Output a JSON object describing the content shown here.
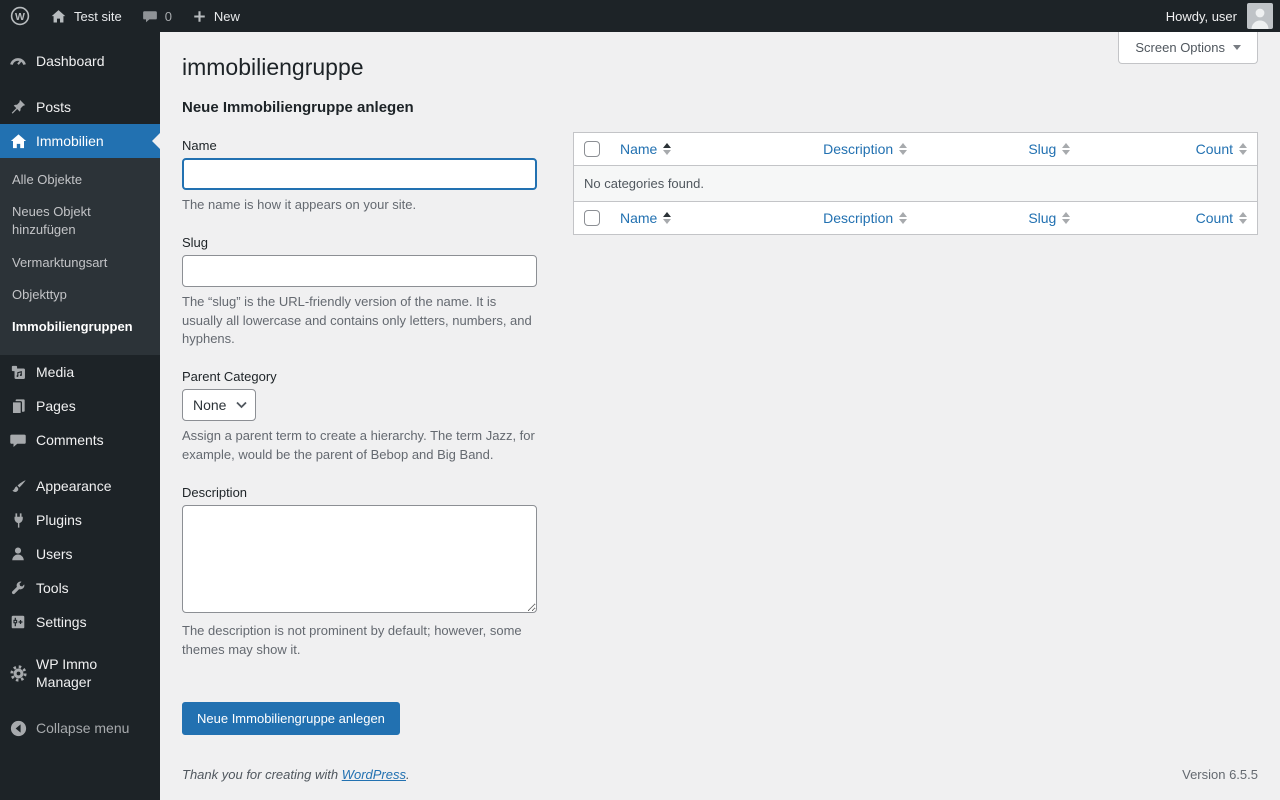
{
  "admin_bar": {
    "site_name": "Test site",
    "comments_count": "0",
    "new_label": "New",
    "howdy": "Howdy, user"
  },
  "sidebar": {
    "items": [
      {
        "label": "Dashboard",
        "icon": "dashboard-icon"
      },
      {
        "label": "Posts",
        "icon": "pin-icon"
      },
      {
        "label": "Immobilien",
        "icon": "house-icon",
        "active": true
      },
      {
        "label": "Media",
        "icon": "media-icon"
      },
      {
        "label": "Pages",
        "icon": "pages-icon"
      },
      {
        "label": "Comments",
        "icon": "comment-icon"
      },
      {
        "label": "Appearance",
        "icon": "brush-icon"
      },
      {
        "label": "Plugins",
        "icon": "plug-icon"
      },
      {
        "label": "Users",
        "icon": "user-icon"
      },
      {
        "label": "Tools",
        "icon": "wrench-icon"
      },
      {
        "label": "Settings",
        "icon": "settings-icon"
      },
      {
        "label": "WP Immo Manager",
        "icon": "gear-icon"
      }
    ],
    "submenu": [
      {
        "label": "Alle Objekte"
      },
      {
        "label": "Neues Objekt hinzufügen"
      },
      {
        "label": "Vermarktungsart"
      },
      {
        "label": "Objekttyp"
      },
      {
        "label": "Immobiliengruppen",
        "current": true
      }
    ],
    "collapse_label": "Collapse menu"
  },
  "page": {
    "title": "immobiliengruppe",
    "screen_options_label": "Screen Options"
  },
  "form": {
    "heading": "Neue Immobiliengruppe anlegen",
    "name_label": "Name",
    "name_value": "",
    "name_help": "The name is how it appears on your site.",
    "slug_label": "Slug",
    "slug_value": "",
    "slug_help": "The “slug” is the URL-friendly version of the name. It is usually all lowercase and contains only letters, numbers, and hyphens.",
    "parent_label": "Parent Category",
    "parent_value": "None",
    "parent_help": "Assign a parent term to create a hierarchy. The term Jazz, for example, would be the parent of Bebop and Big Band.",
    "description_label": "Description",
    "description_value": "",
    "description_help": "The description is not prominent by default; however, some themes may show it.",
    "submit_label": "Neue Immobiliengruppe anlegen"
  },
  "table": {
    "columns": [
      "Name",
      "Description",
      "Slug",
      "Count"
    ],
    "sorted_column": "Name",
    "sort_direction": "asc",
    "empty_message": "No categories found."
  },
  "footer": {
    "thanks_prefix": "Thank you for creating with",
    "wordpress_link": "WordPress",
    "thanks_suffix": ".",
    "version": "Version 6.5.5"
  },
  "colors": {
    "accent": "#2271b1",
    "admin_bar_bg": "#1d2327",
    "menu_bg": "#1d2327",
    "submenu_bg": "#2c3338",
    "content_bg": "#f0f0f1",
    "table_border": "#c3c4c7",
    "help_text": "#646970",
    "heading_text": "#1d2327"
  }
}
